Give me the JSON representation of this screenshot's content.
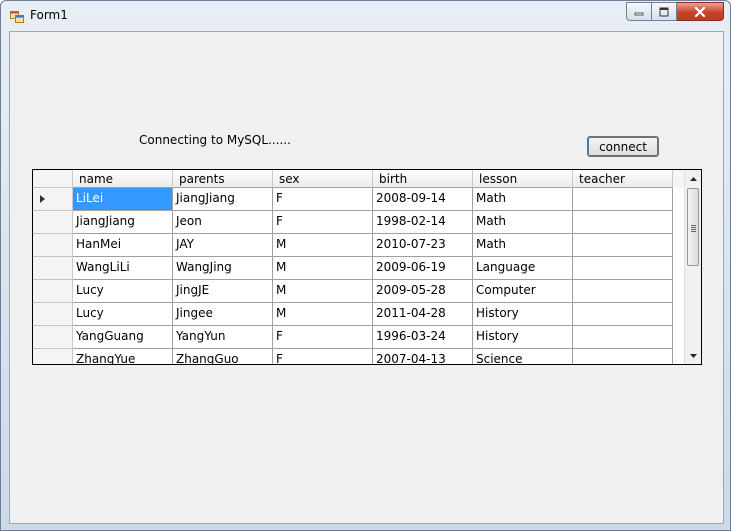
{
  "window": {
    "title": "Form1"
  },
  "form": {
    "status_text": "Connecting to MySQL......",
    "connect_label": "connect"
  },
  "grid": {
    "columns": [
      "name",
      "parents",
      "sex",
      "birth",
      "lesson",
      "teacher"
    ],
    "selected_row": 0,
    "rows": [
      [
        "LiLei",
        "JiangJiang",
        "F",
        "2008-09-14",
        "Math",
        ""
      ],
      [
        "JiangJiang",
        "Jeon",
        "F",
        "1998-02-14",
        "Math",
        ""
      ],
      [
        "HanMei",
        "JAY",
        "M",
        "2010-07-23",
        "Math",
        ""
      ],
      [
        "WangLiLi",
        "WangJing",
        "M",
        "2009-06-19",
        "Language",
        ""
      ],
      [
        "Lucy",
        "JingJE",
        "M",
        "2009-05-28",
        "Computer",
        ""
      ],
      [
        "Lucy",
        "Jingee",
        "M",
        "2011-04-28",
        "History",
        ""
      ],
      [
        "YangGuang",
        "YangYun",
        "F",
        "1996-03-24",
        "History",
        ""
      ],
      [
        "ZhangYue",
        "ZhangGuo",
        "F",
        "2007-04-13",
        "Science",
        ""
      ]
    ]
  },
  "icons": {
    "app": "form-app-icon",
    "minimize": "minimize-icon",
    "maximize": "maximize-icon",
    "close": "close-icon",
    "row_pointer": "row-pointer-icon",
    "scroll_up": "scroll-up-icon",
    "scroll_down": "scroll-down-icon"
  },
  "colors": {
    "selection": "#3399ff",
    "close_button": "#c9442b",
    "client_background": "#f0f0f0"
  }
}
